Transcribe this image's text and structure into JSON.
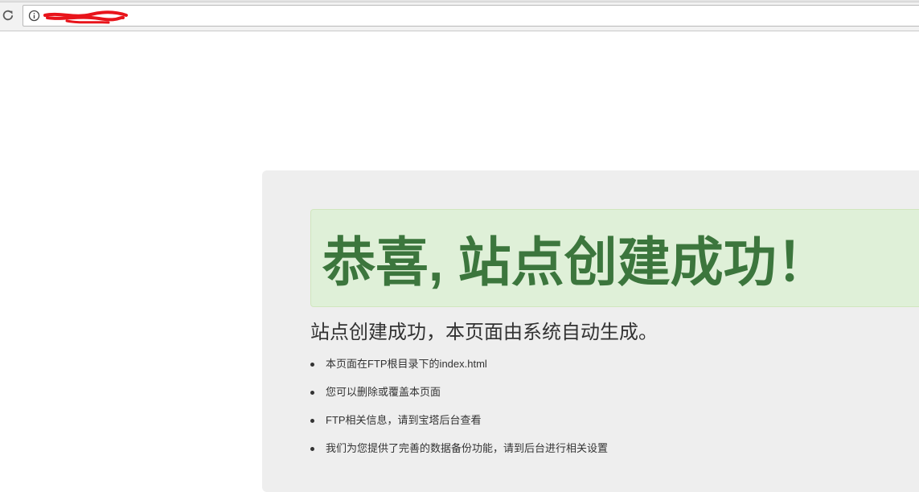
{
  "browser": {
    "url": "",
    "url_redacted": true,
    "colors": {
      "toolbar": "#f2f2f2",
      "redaction": "#e8141b"
    },
    "icons": {
      "reload": "reload-icon",
      "site_info": "info-icon"
    }
  },
  "page": {
    "alert_title": "恭喜, 站点创建成功！",
    "lead": "站点创建成功，本页面由系统自动生成。",
    "items": [
      "本页面在FTP根目录下的index.html",
      "您可以删除或覆盖本页面",
      "FTP相关信息，请到宝塔后台查看",
      "我们为您提供了完善的数据备份功能，请到后台进行相关设置"
    ],
    "colors": {
      "panel_bg": "#eeeeee",
      "alert_bg": "#dff0d8",
      "alert_text": "#3c763d",
      "body_text": "#333333"
    }
  }
}
